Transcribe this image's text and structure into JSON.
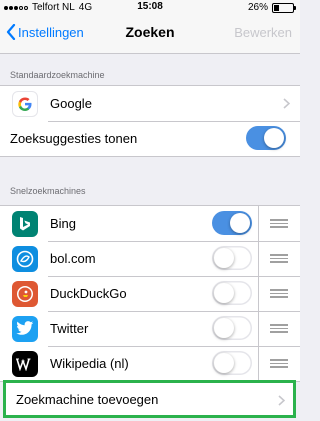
{
  "status": {
    "carrier": "Telfort NL",
    "network": "4G",
    "time": "15:08",
    "battery_label": "26%",
    "battery_level": 0.26
  },
  "nav": {
    "back_label": "Instellingen",
    "title": "Zoeken",
    "edit_label": "Bewerken"
  },
  "default_section": {
    "header": "Standaardzoekmachine",
    "engine": "Google",
    "suggestions_label": "Zoeksuggesties tonen",
    "suggestions_on": true
  },
  "quick_section": {
    "header": "Snelzoekmachines",
    "items": [
      {
        "label": "Bing",
        "icon": "bing-icon",
        "enabled": true
      },
      {
        "label": "bol.com",
        "icon": "bolcom-icon",
        "enabled": false
      },
      {
        "label": "DuckDuckGo",
        "icon": "duckduckgo-icon",
        "enabled": false
      },
      {
        "label": "Twitter",
        "icon": "twitter-icon",
        "enabled": false
      },
      {
        "label": "Wikipedia (nl)",
        "icon": "wikipedia-icon",
        "enabled": false
      }
    ]
  },
  "add_engine": {
    "label": "Zoekmachine toevoegen"
  },
  "colors": {
    "accent": "#007aff",
    "toggle_on": "#4a90e2",
    "highlight": "#2bb24c",
    "bing": "#008373",
    "bolcom": "#0e8ee0",
    "duckduckgo": "#de5833",
    "twitter": "#1da1f2",
    "wikipedia": "#000000"
  }
}
